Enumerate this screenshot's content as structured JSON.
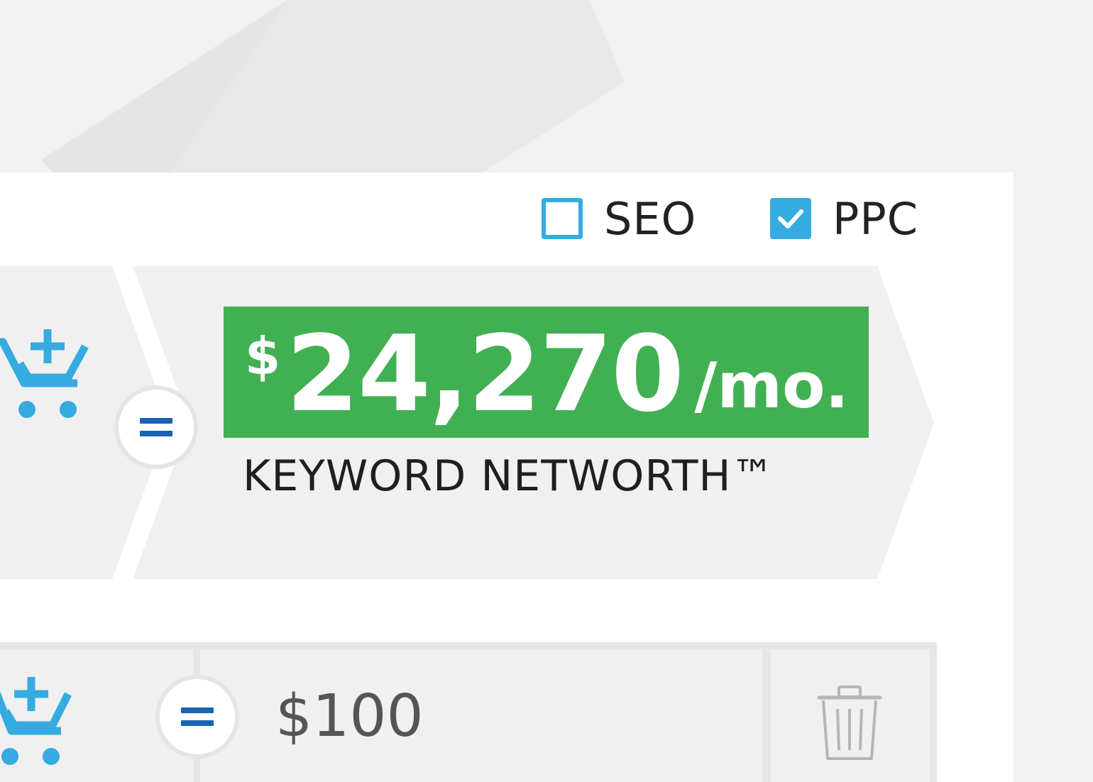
{
  "filters": {
    "seo": {
      "label": "SEO",
      "checked": false
    },
    "ppc": {
      "label": "PPC",
      "checked": true
    }
  },
  "summary": {
    "currency_symbol": "$",
    "amount": "24,270",
    "unit": "/mo.",
    "label": "KEYWORD NETWORTH™"
  },
  "row": {
    "value": "$100"
  },
  "icons": {
    "cart": "add-to-cart-icon",
    "equals": "equals-icon",
    "trash": "trash-icon",
    "check": "checkmark-icon"
  },
  "colors": {
    "accent_blue": "#35abe0",
    "price_green": "#41b053",
    "equals_blue": "#1863b6",
    "trash_gray": "#b5b5b5"
  }
}
